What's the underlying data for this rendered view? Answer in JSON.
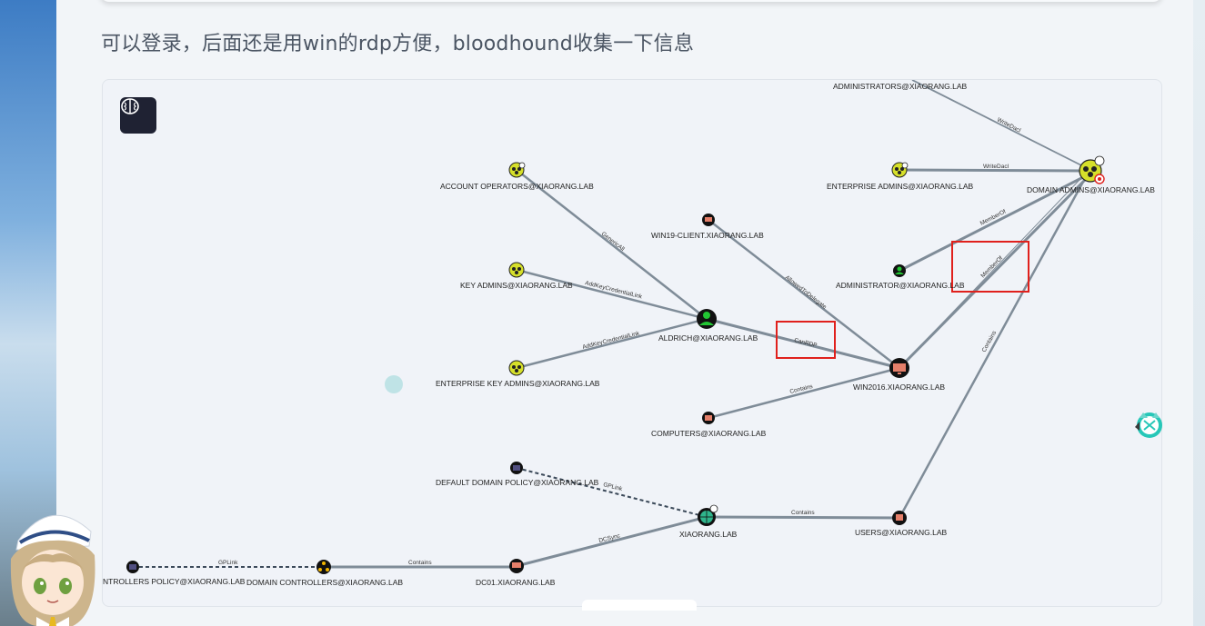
{
  "caption": "可以登录，后面还是用win的rdp方便，bloodhound收集一下信息",
  "graph": {
    "menu_button_icon": "brain-icon",
    "nodes": [
      {
        "id": "admins_grp",
        "label": "ADMINISTRATORS@XIAORANG.LAB",
        "type": "group"
      },
      {
        "id": "ent_admins",
        "label": "ENTERPRISE ADMINS@XIAORANG.LAB",
        "type": "group"
      },
      {
        "id": "domain_admins",
        "label": "DOMAIN ADMINS@XIAORANG.LAB",
        "type": "group"
      },
      {
        "id": "acct_ops",
        "label": "ACCOUNT OPERATORS@XIAORANG.LAB",
        "type": "group"
      },
      {
        "id": "win19",
        "label": "WIN19-CLIENT.XIAORANG.LAB",
        "type": "computer"
      },
      {
        "id": "key_admins",
        "label": "KEY ADMINS@XIAORANG.LAB",
        "type": "group"
      },
      {
        "id": "administrator",
        "label": "ADMINISTRATOR@XIAORANG.LAB",
        "type": "user"
      },
      {
        "id": "aldrich",
        "label": "ALDRICH@XIAORANG.LAB",
        "type": "user"
      },
      {
        "id": "win2016",
        "label": "WIN2016.XIAORANG.LAB",
        "type": "computer"
      },
      {
        "id": "ent_key_admins",
        "label": "ENTERPRISE KEY ADMINS@XIAORANG.LAB",
        "type": "group"
      },
      {
        "id": "computers",
        "label": "COMPUTERS@XIAORANG.LAB",
        "type": "container"
      },
      {
        "id": "default_policy",
        "label": "DEFAULT DOMAIN POLICY@XIAORANG.LAB",
        "type": "gpo"
      },
      {
        "id": "domain",
        "label": "XIAORANG.LAB",
        "type": "domain"
      },
      {
        "id": "users",
        "label": "USERS@XIAORANG.LAB",
        "type": "container"
      },
      {
        "id": "dc_policy",
        "label": "NTROLLERS POLICY@XIAORANG.LAB",
        "type": "gpo"
      },
      {
        "id": "dc_ou",
        "label": "DOMAIN CONTROLLERS@XIAORANG.LAB",
        "type": "ou"
      },
      {
        "id": "dc01",
        "label": "DC01.XIAORANG.LAB",
        "type": "computer"
      }
    ],
    "edges": [
      {
        "label": "WriteDacl"
      },
      {
        "label": "WriteDacl"
      },
      {
        "label": "MemberOf"
      },
      {
        "label": "MemberOf"
      },
      {
        "label": "GenericAll"
      },
      {
        "label": "AllowedToDelegate"
      },
      {
        "label": "AddKeyCredentialLink"
      },
      {
        "label": "AddKeyCredentialLink"
      },
      {
        "label": "CanRDP"
      },
      {
        "label": "Contains"
      },
      {
        "label": "Contains"
      },
      {
        "label": "GPLink"
      },
      {
        "label": "Contains"
      },
      {
        "label": "DCSync"
      },
      {
        "label": "GPLink"
      },
      {
        "label": "Contains"
      }
    ]
  },
  "colors": {
    "highlight": "#e0201c",
    "edge": "#7f8c98",
    "group_node": "#d6e02a",
    "user_node": "#22c533",
    "computer_node": "#e57f6a",
    "domain_node": "#2fb58c"
  }
}
